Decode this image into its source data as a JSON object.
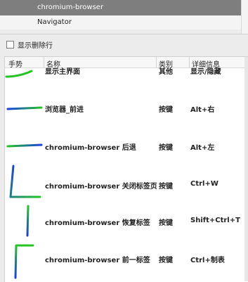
{
  "top_list": {
    "selected_item": "chromium-browser",
    "second_item": "Navigator"
  },
  "options": {
    "show_deleted_label": "显示删除行"
  },
  "table": {
    "columns": [
      "手势",
      "名称",
      "类别",
      "详细信息"
    ],
    "rows": [
      {
        "name": "显示主界面",
        "category": "其他",
        "detail": "显示/隐藏"
      },
      {
        "name": "浏览器_前进",
        "category": "按键",
        "detail": "Alt+右"
      },
      {
        "name": "chromium-browser 后退",
        "category": "按键",
        "detail": "Alt+左"
      },
      {
        "name": "chromium-browser 关闭标签页",
        "category": "按键",
        "detail": "Ctrl+W"
      },
      {
        "name": "chromium-browser 恢复标签",
        "category": "按键",
        "detail": "Shift+Ctrl+T"
      },
      {
        "name": "chromium-browser 前一标签",
        "category": "按键",
        "detail": "Ctrl+制表"
      }
    ]
  },
  "colors": {
    "selection": "#7e7e7e",
    "stroke_start": "#1a3fe0",
    "stroke_end": "#23c423"
  }
}
